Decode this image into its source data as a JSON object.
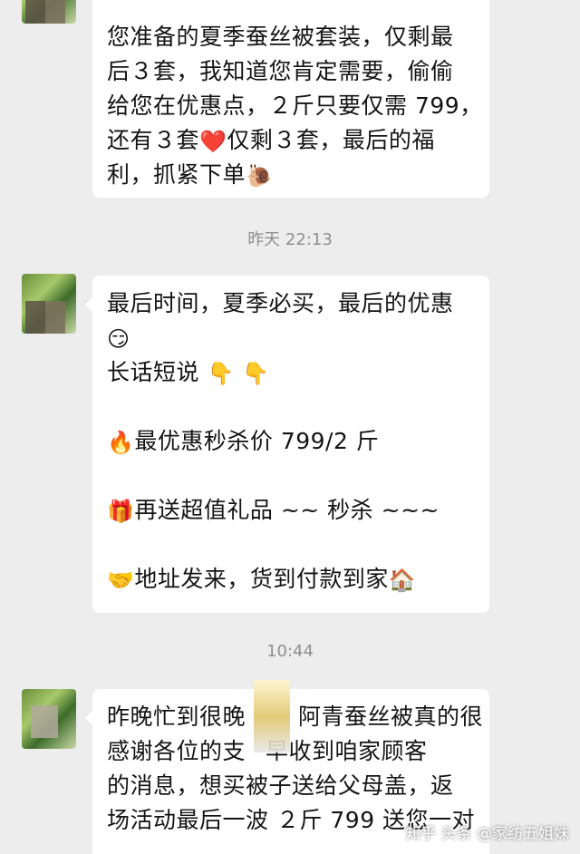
{
  "timestamps": {
    "t1": "昨天 22:13",
    "t2": "10:44"
  },
  "messages": {
    "m1": {
      "lines": [
        "您准备的夏季蚕丝被套装，仅剩最",
        "后３套，我知道您肯定需要，偷偷",
        "给您在优惠点，２斤只要仅需 799，",
        "还有３套",
        "仅剩３套，最后的福",
        "利，抓紧下单"
      ],
      "emojis": {
        "heart": "❤️",
        "snail": "🐌"
      }
    },
    "m2": {
      "lines": [
        "最后时间，夏季必买，最后的优惠",
        "长话短说",
        "最优惠秒杀价 799/2 斤",
        "再送超值礼品 ~~ 秒杀 ~~~",
        "地址发来，货到付款到家"
      ],
      "emojis": {
        "smirk": "😏",
        "point_down": "👇",
        "fire": "🔥",
        "gift": "🎁",
        "handshake": "🤝",
        "house": "🏠"
      }
    },
    "m3": {
      "lines": [
        "昨晚忙到很晚",
        "阿青蚕丝被真的很",
        "感谢各位的支",
        "早收到咱家顾客",
        "的消息，想买被子送给父母盖，返",
        "场活动最后一波 ２斤 799 送您一对"
      ]
    }
  },
  "watermark": "知乎 头条 @家纺五姐妹"
}
